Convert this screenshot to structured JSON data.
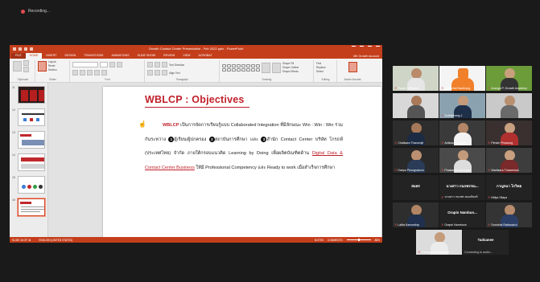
{
  "meeting": {
    "recording_label": "Recording..."
  },
  "ppt": {
    "title": "Growth Contact Center Presentation - Feb 2022.pptx - PowerPoint",
    "signin_label": "MK Growth Account",
    "tabs": [
      "FILE",
      "HOME",
      "INSERT",
      "DESIGN",
      "TRANSITIONS",
      "ANIMATIONS",
      "SLIDE SHOW",
      "REVIEW",
      "VIEW",
      "ACROBAT"
    ],
    "groups": {
      "clipboard": "Clipboard",
      "slides": "Slides",
      "font": "Font",
      "paragraph": "Paragraph",
      "drawing": "Drawing",
      "editing": "Editing",
      "adobe": "Adobe Acrobat"
    },
    "ribbon_labels": {
      "paste": "Paste",
      "new_slide": "New Slide",
      "layout": "Layout",
      "reset": "Reset",
      "section": "Section",
      "text_direction": "Text Direction",
      "align_text": "Align Text",
      "convert_smartart": "Convert to SmartArt",
      "arrange": "Arrange",
      "quick_styles": "Quick Styles",
      "shape_fill": "Shape Fill",
      "shape_outline": "Shape Outline",
      "shape_effects": "Shape Effects",
      "find": "Find",
      "replace": "Replace",
      "select": "Select",
      "create_pdf": "Create and Share Adobe PDF"
    },
    "slide": {
      "title": "WBLCP : Objectives",
      "p1_brand": "WBLCP",
      "p1_text": " เป็นการจัดการเรียนรู้แบบ Collaborated Integration ที่มีลักษณะ Win : Win : Win ร่วมกันระหว่าง ",
      "c1": "1",
      "p1_party1": "ผู้เรียน/ผู้ปกครอง ",
      "c2": "2",
      "p1_party2": "สถาบันการศึกษา และ ",
      "c3": "3",
      "p1_party3": "สำนัก Contact Center บริษัท โกรธฟ์ (ประเทศไทย) จำกัด ภายใต้กรอบแนวคิด Learning by Doing เพื่อผลิตบัณฑิตด้าน ",
      "p1_link": "Digital Data & Contact Center Business",
      "p1_tail": " ให้มี Professional Competency และ Ready to work เมื่อสำเร็จการศึกษา"
    },
    "thumb_numbers": [
      "11",
      "12",
      "13",
      "14",
      "15",
      "16"
    ],
    "status": {
      "left": "SLIDE 16 OF 44",
      "lang": "ENGLISH (UNITED STATES)",
      "notes": "NOTES",
      "comments": "COMMENTS",
      "zoom": "88%"
    }
  },
  "participants": [
    {
      "name": "Ruyan Sittisukrit",
      "kind": "video",
      "muted": true
    },
    {
      "name": "Chanchai Hanthong",
      "kind": "video",
      "muted": true
    },
    {
      "name": "Ananya P. Growth Academy",
      "kind": "video",
      "muted": true
    },
    {
      "name": "",
      "kind": "video",
      "muted": false
    },
    {
      "name": "Sutthiphong J.",
      "kind": "video",
      "muted": true
    },
    {
      "name": "",
      "kind": "video",
      "muted": false
    },
    {
      "name": "Chalisara Thanomjit",
      "kind": "video",
      "muted": true
    },
    {
      "name": "Aekkarat Jaidee",
      "kind": "video",
      "muted": true
    },
    {
      "name": "Pimsiri Phuwong",
      "kind": "video",
      "muted": true
    },
    {
      "name": "Dariya Phongsakorn",
      "kind": "video",
      "muted": true
    },
    {
      "name": "Phakamas Muangsri",
      "kind": "video",
      "muted": true
    },
    {
      "name": "Waritsara Thaweesuk",
      "kind": "video",
      "muted": true
    },
    {
      "name": "",
      "label": "สมพร",
      "kind": "name",
      "muted": true
    },
    {
      "name": "นางสาว กนกพร หอมจันทร์",
      "label": "นางสาว กนกพรรณ...",
      "kind": "name",
      "muted": true
    },
    {
      "name": "Nitiya Silapa",
      "label": "กาญจนา โกวิทย",
      "kind": "name",
      "muted": true
    },
    {
      "name": "Lalita Kamonthip",
      "kind": "video",
      "muted": true
    },
    {
      "name": "Orapin Namboon",
      "label": "Orapin  Nambun...",
      "kind": "name",
      "muted": true
    },
    {
      "name": "Somchai Rattanakul",
      "kind": "video",
      "muted": true
    },
    {
      "name": "Thanaphat Yodmanee",
      "kind": "video",
      "muted": true
    },
    {
      "name": "Connecting to audio...",
      "label": "Tadsanee",
      "kind": "name",
      "muted": false
    }
  ],
  "colors": {
    "accent": "#c43e1c",
    "title_red": "#c0202a",
    "speaker_ring": "#9cde55"
  }
}
